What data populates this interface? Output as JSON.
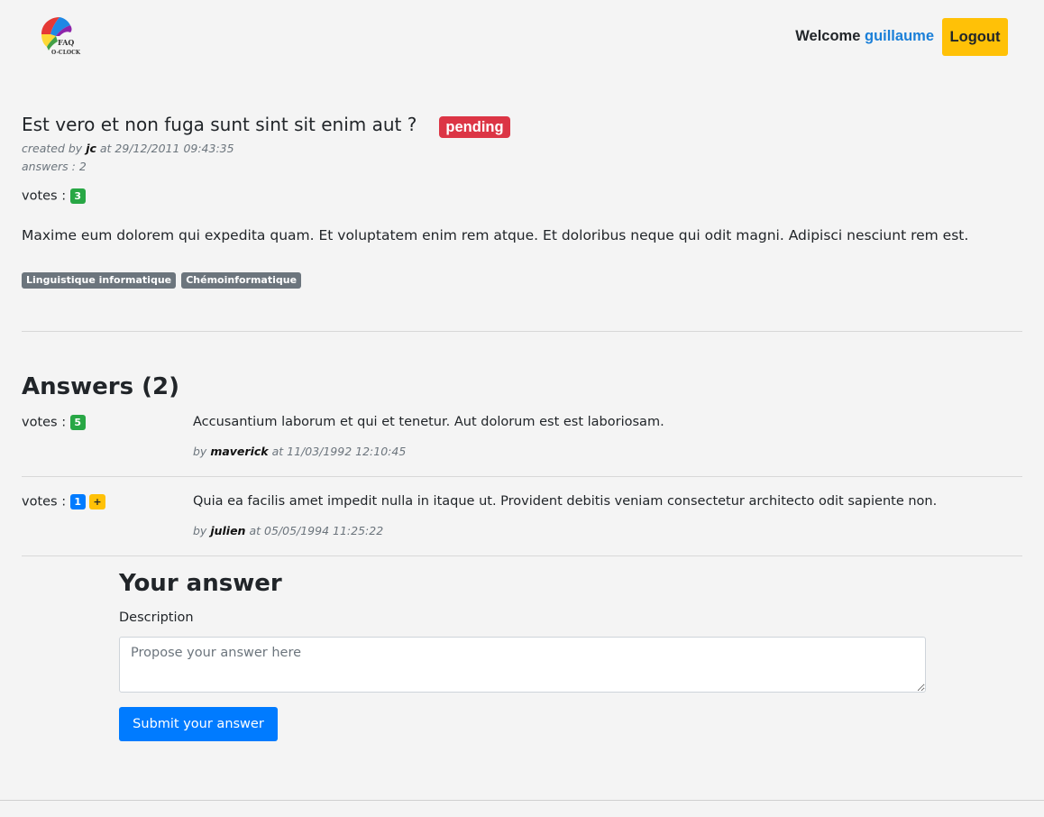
{
  "header": {
    "logo_text": "FAQ O-CLOCK",
    "welcome_label": "Welcome",
    "username": "guillaume",
    "logout_label": "Logout"
  },
  "question": {
    "title": "Est vero et non fuga sunt sint sit enim aut ?",
    "status": "pending",
    "created_by_prefix": "created by",
    "author": "jc",
    "at_label": "at",
    "created_at": "29/12/2011 09:43:35",
    "answers_count_text": "answers : 2",
    "votes_label": "votes :",
    "votes": "3",
    "body": "Maxime eum dolorem qui expedita quam. Et voluptatem enim rem atque. Et doloribus neque qui odit magni. Adipisci nesciunt rem est.",
    "tags": [
      "Linguistique informatique",
      "Chémoinformatique"
    ]
  },
  "answers": {
    "title": "Answers (2)",
    "items": [
      {
        "votes_label": "votes :",
        "votes": "5",
        "body": "Accusantium laborum et qui et tenetur. Aut dolorum est est laboriosam.",
        "by_label": "by",
        "author": "maverick",
        "at_label": "at",
        "date": "11/03/1992 12:10:45"
      },
      {
        "votes_label": "votes :",
        "votes": "1",
        "vote_button": "+",
        "body": "Quia ea facilis amet impedit nulla in itaque ut. Provident debitis veniam consectetur architecto odit sapiente non.",
        "by_label": "by",
        "author": "julien",
        "at_label": "at",
        "date": "05/05/1994 11:25:22"
      }
    ]
  },
  "answer_form": {
    "title": "Your answer",
    "description_label": "Description",
    "placeholder": "Propose your answer here",
    "submit_label": "Submit your answer"
  },
  "colors": {
    "background": "#f4f4f4",
    "primary": "#007bff",
    "warning": "#ffc107",
    "danger": "#dc3545",
    "success": "#28a745",
    "secondary": "#6c757d",
    "link": "#1a7fd8"
  }
}
